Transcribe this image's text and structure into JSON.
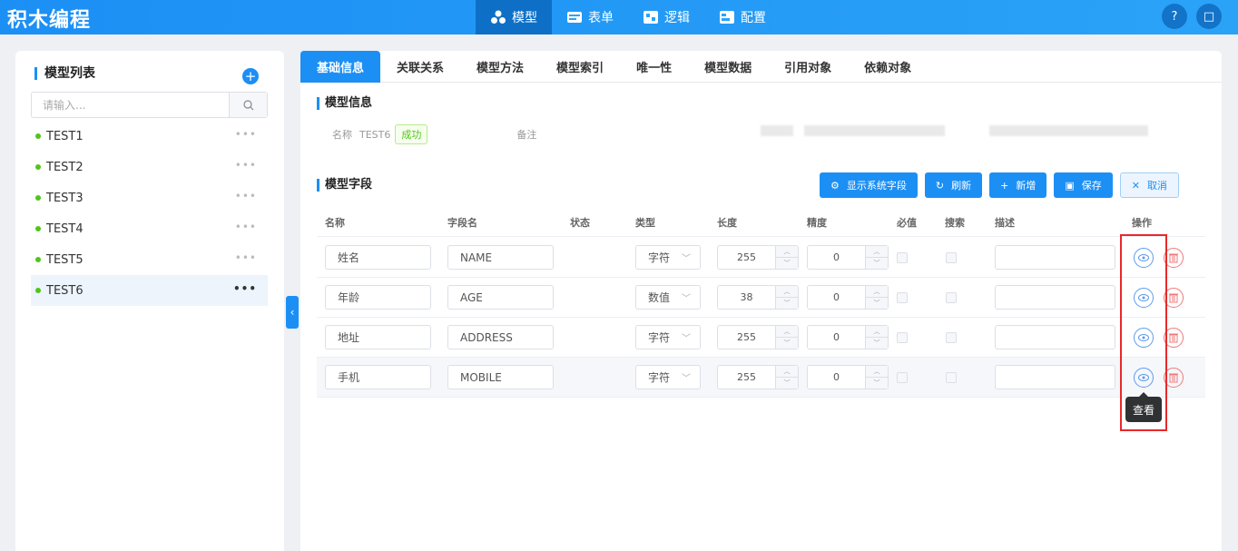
{
  "app": {
    "title": "积木编程"
  },
  "nav": [
    {
      "label": "模型",
      "icon": "cubes-icon",
      "active": true
    },
    {
      "label": "表单",
      "icon": "form-icon"
    },
    {
      "label": "逻辑",
      "icon": "logic-icon"
    },
    {
      "label": "配置",
      "icon": "config-icon"
    }
  ],
  "sidebar": {
    "title": "模型列表",
    "search_placeholder": "请输入...",
    "items": [
      {
        "label": "TEST1"
      },
      {
        "label": "TEST2"
      },
      {
        "label": "TEST3"
      },
      {
        "label": "TEST4"
      },
      {
        "label": "TEST5"
      },
      {
        "label": "TEST6",
        "active": true
      }
    ]
  },
  "tabs": [
    "基础信息",
    "关联关系",
    "模型方法",
    "模型索引",
    "唯一性",
    "模型数据",
    "引用对象",
    "依赖对象"
  ],
  "model_info": {
    "title": "模型信息",
    "name_label": "名称",
    "name_value": "TEST6",
    "status_badge": "成功",
    "remark_label": "备注"
  },
  "fields": {
    "title": "模型字段",
    "buttons": {
      "show_system": "显示系统字段",
      "refresh": "刷新",
      "add": "新增",
      "save": "保存",
      "cancel": "取消"
    },
    "columns": [
      "名称",
      "字段名",
      "状态",
      "类型",
      "长度",
      "精度",
      "必值",
      "搜索",
      "描述",
      "操作"
    ],
    "rows": [
      {
        "name": "姓名",
        "field": "NAME",
        "type": "字符",
        "length": "255",
        "precision": "0"
      },
      {
        "name": "年龄",
        "field": "AGE",
        "type": "数值",
        "length": "38",
        "precision": "0"
      },
      {
        "name": "地址",
        "field": "ADDRESS",
        "type": "字符",
        "length": "255",
        "precision": "0"
      },
      {
        "name": "手机",
        "field": "MOBILE",
        "type": "字符",
        "length": "255",
        "precision": "0"
      }
    ]
  },
  "tooltip": "查看",
  "colors": {
    "primary": "#1c8ff5",
    "success": "#52c41a",
    "danger": "#f27878",
    "highlight": "#e8292a"
  }
}
